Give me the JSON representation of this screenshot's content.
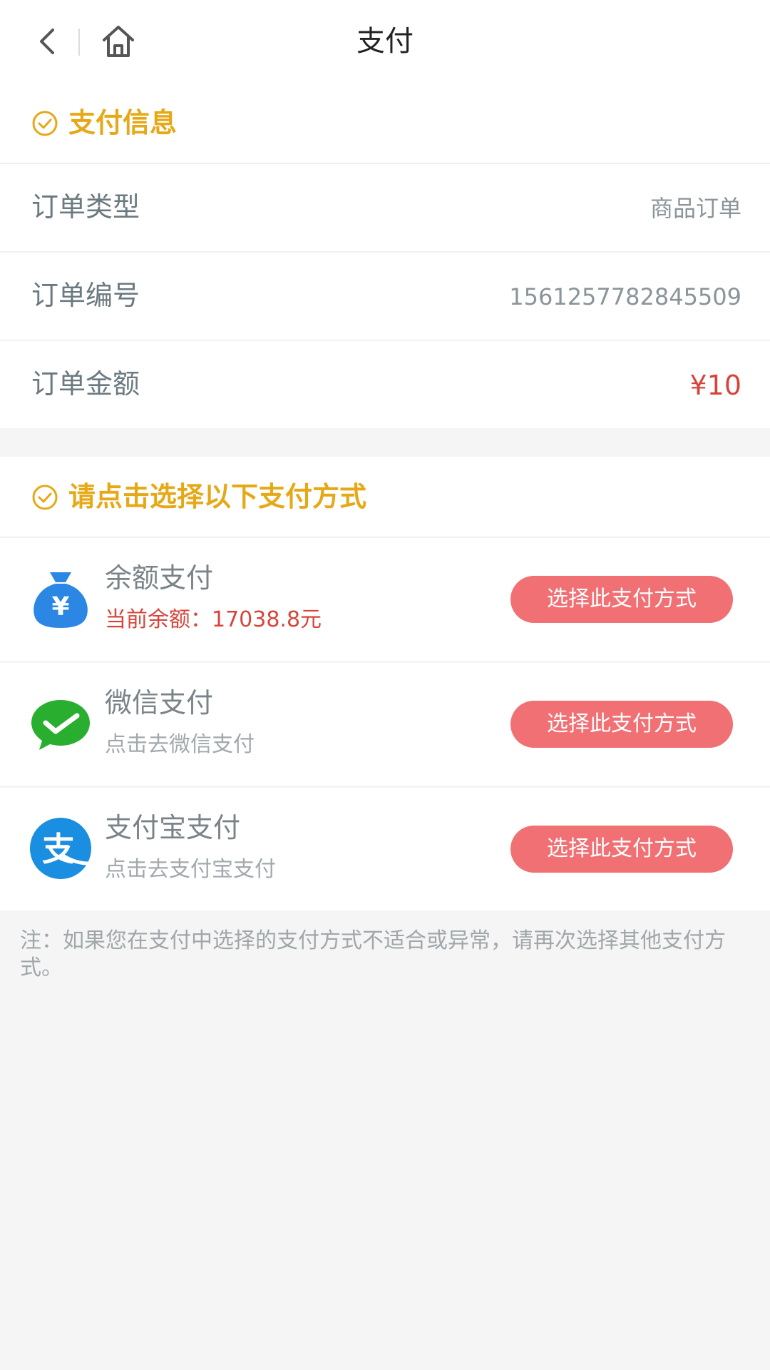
{
  "header": {
    "title": "支付",
    "back_icon": "chevron-left-icon",
    "home_icon": "home-icon"
  },
  "payment_info": {
    "title": "支付信息",
    "rows": [
      {
        "label": "订单类型",
        "value": "商品订单"
      },
      {
        "label": "订单编号",
        "value": "1561257782845509"
      },
      {
        "label": "订单金额",
        "value": "¥10"
      }
    ]
  },
  "payment_methods": {
    "title": "请点击选择以下支付方式",
    "items": [
      {
        "name": "余额支付",
        "subtitle": "当前余额：17038.8元",
        "button": "选择此支付方式",
        "icon": "money-bag-icon"
      },
      {
        "name": "微信支付",
        "subtitle": "点击去微信支付",
        "button": "选择此支付方式",
        "icon": "wechat-icon"
      },
      {
        "name": "支付宝支付",
        "subtitle": "点击去支付宝支付",
        "button": "选择此支付方式",
        "icon": "alipay-icon"
      }
    ]
  },
  "note": "注：如果您在支付中选择的支付方式不适合或异常，请再次选择其他支付方式。",
  "colors": {
    "accent": "#e6a817",
    "price": "#d6453b",
    "button": "#f07074",
    "wechat": "#2aae2f",
    "alipay": "#1a8ee1",
    "balance": "#2b87e3"
  }
}
